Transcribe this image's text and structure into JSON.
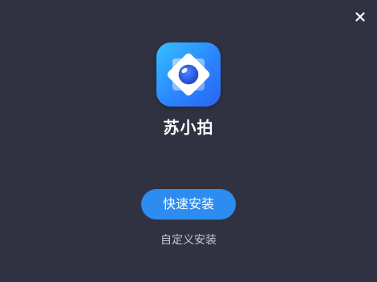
{
  "window": {
    "close_icon": "close-icon"
  },
  "app": {
    "name": "苏小拍",
    "icon": "camera-lens-app-icon"
  },
  "actions": {
    "quick_install_label": "快速安装",
    "custom_install_label": "自定义安装"
  },
  "colors": {
    "background": "#313241",
    "primary_button": "#2d8cf0",
    "text_primary": "#ffffff",
    "text_secondary": "#c5c7d2"
  }
}
